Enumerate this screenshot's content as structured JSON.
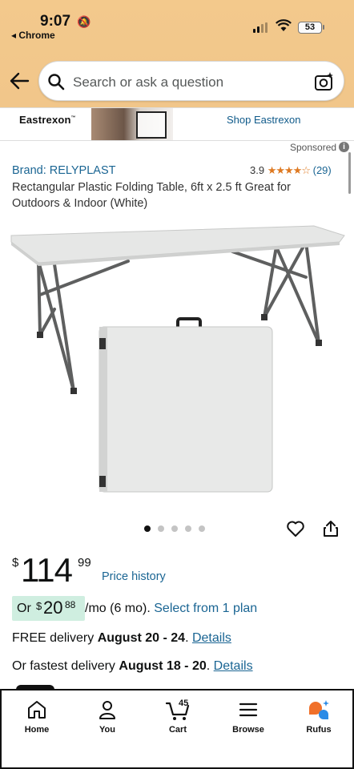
{
  "status": {
    "time": "9:07",
    "back_app": "◂ Chrome",
    "battery": "53"
  },
  "search": {
    "placeholder": "Search or ask a question"
  },
  "banner": {
    "logo": "Eastrexon",
    "shop_link": "Shop Eastrexon"
  },
  "sponsored": "Sponsored",
  "product": {
    "brand": "Brand: RELYPLAST",
    "rating_value": "3.9",
    "rating_stars": 3.9,
    "rating_count": "(29)",
    "title": "Rectangular Plastic Folding Table, 6ft x 2.5 ft Great for Outdoors & Indoor (White)",
    "image_count": 5,
    "image_active": 1
  },
  "price": {
    "currency": "$",
    "whole": "114",
    "fraction": "99",
    "history_link": "Price history"
  },
  "plan": {
    "or": "Or",
    "currency": "$",
    "whole": "20",
    "fraction": "88",
    "term": "/mo (6 mo).",
    "select": "Select from 1 plan"
  },
  "delivery": {
    "free_prefix": "FREE delivery",
    "free_dates": "August 20 - 24",
    "free_suffix": ".",
    "free_link": "Details",
    "fast_prefix": "Or fastest delivery",
    "fast_dates": "August 18 - 20",
    "fast_suffix": ".",
    "fast_link": "Details"
  },
  "tabbar": {
    "home": "Home",
    "you": "You",
    "cart": "Cart",
    "cart_count": "45",
    "browse": "Browse",
    "rufus": "Rufus"
  },
  "colors": {
    "top_gradient": "#f3c98c",
    "link": "#1a6593",
    "star": "#de7921",
    "plan_highlight": "#cfeee0",
    "rufus_orange": "#f0702a",
    "rufus_blue": "#2b8be6"
  }
}
